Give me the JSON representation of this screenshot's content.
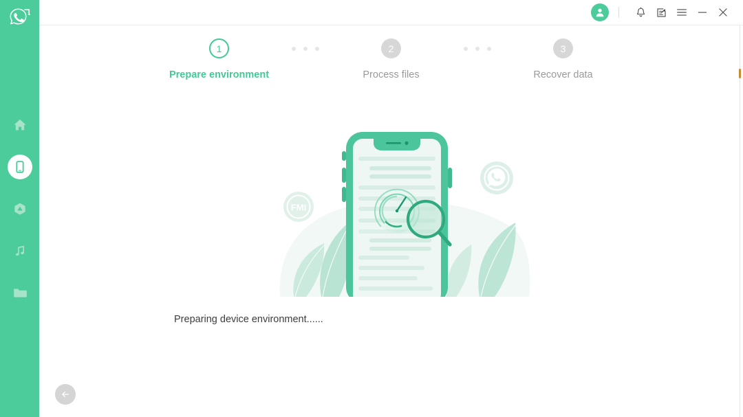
{
  "app": {
    "logo_icon": "whatsapp-recovery-logo",
    "accent_color": "#4ccb9b",
    "sidebar_color": "#4ccb9b"
  },
  "sidebar": {
    "items": [
      {
        "id": "home",
        "icon": "home-icon",
        "label": "Home",
        "active": false
      },
      {
        "id": "device",
        "icon": "device-icon",
        "label": "Device",
        "active": true
      },
      {
        "id": "backup",
        "icon": "cloud-icon",
        "label": "Backup",
        "active": false
      },
      {
        "id": "music",
        "icon": "music-icon",
        "label": "Music",
        "active": false
      },
      {
        "id": "files",
        "icon": "folder-icon",
        "label": "Files",
        "active": false
      }
    ]
  },
  "titlebar": {
    "avatar_icon": "user-avatar-icon",
    "buttons": [
      {
        "id": "notifications",
        "icon": "bell-icon"
      },
      {
        "id": "feedback",
        "icon": "note-edit-icon"
      },
      {
        "id": "menu",
        "icon": "hamburger-menu-icon"
      },
      {
        "id": "minimize",
        "icon": "minimize-icon"
      },
      {
        "id": "close",
        "icon": "close-icon"
      }
    ]
  },
  "steps": [
    {
      "number": "1",
      "label": "Prepare environment",
      "state": "active"
    },
    {
      "number": "2",
      "label": "Process files",
      "state": "idle"
    },
    {
      "number": "3",
      "label": "Recover data",
      "state": "idle"
    }
  ],
  "illustration": {
    "name": "phone-scan-illustration",
    "badges": [
      {
        "id": "fmi",
        "text": "FMI",
        "icon": "fmi-badge-icon"
      },
      {
        "id": "whatsapp",
        "text": "",
        "icon": "whatsapp-badge-icon"
      }
    ],
    "elements": [
      "phone",
      "document-lines",
      "gauge",
      "magnifier",
      "leaves"
    ]
  },
  "status": {
    "text": "Preparing device environment......"
  },
  "back_button": {
    "icon": "arrow-left-icon",
    "label": "Back"
  },
  "colors": {
    "accent": "#44c995",
    "sidebar": "#4ccb9b",
    "step_idle": "#d7d7d7",
    "step_idle_text": "#9a9a9a",
    "status_text": "#3c3c3c",
    "back_button_bg": "#d5d5d5"
  }
}
